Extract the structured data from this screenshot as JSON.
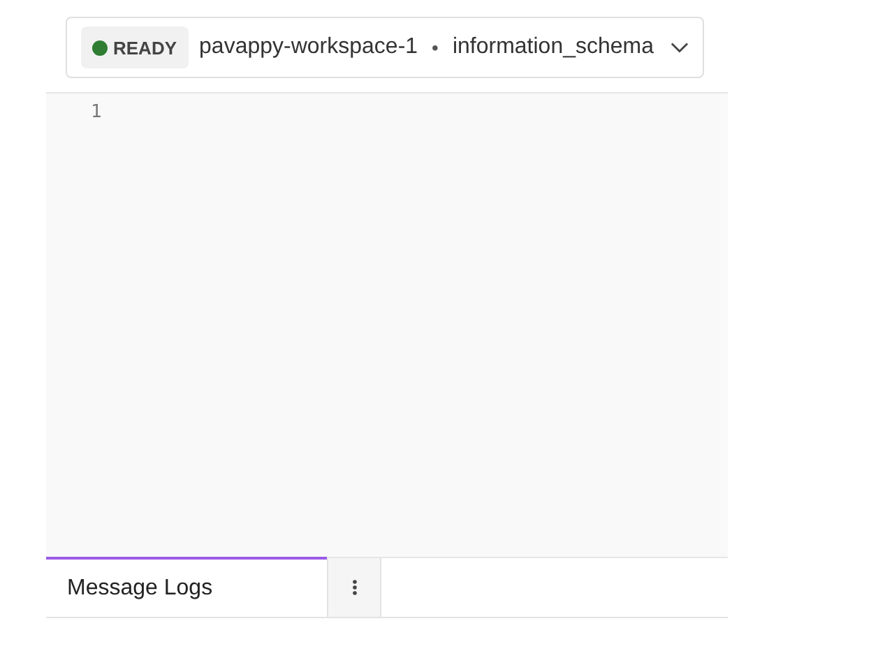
{
  "connection": {
    "status": {
      "label": "READY",
      "color": "#2e7d32"
    },
    "workspace": "pavappy-workspace-1",
    "separator": "•",
    "schema": "information_schema"
  },
  "editor": {
    "line_numbers": [
      "1"
    ]
  },
  "bottom_panel": {
    "tabs": [
      {
        "label": "Message Logs",
        "selected": true
      }
    ]
  }
}
